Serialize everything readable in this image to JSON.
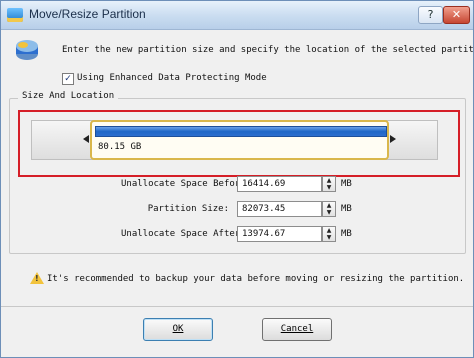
{
  "window": {
    "title": "Move/Resize Partition"
  },
  "title_buttons": {
    "help": "?",
    "close": "✕"
  },
  "intro_text": "Enter the new partition size and specify the location of the selected partition.",
  "option": {
    "label": "Using Enhanced Data Protecting Mode",
    "checked": true,
    "check_glyph": "✓"
  },
  "group": {
    "label": "Size And Location"
  },
  "partition_map": {
    "size_label": "80.15 GB",
    "left_handle": "left-resize-handle-icon",
    "right_handle": "right-resize-handle-icon"
  },
  "fields": [
    {
      "label": "Unallocate Space Before:",
      "value": "16414.69",
      "unit": "MB"
    },
    {
      "label": "Partition Size:",
      "value": "82073.45",
      "unit": "MB"
    },
    {
      "label": "Unallocate Space After:",
      "value": "13974.67",
      "unit": "MB"
    }
  ],
  "warning": {
    "icon": "warning-icon",
    "glyph": "!",
    "text": "It's recommended to backup your data before moving or resizing the partition."
  },
  "buttons": {
    "ok": "OK",
    "cancel": "Cancel"
  },
  "spin_glyphs": {
    "up": "▲",
    "down": "▼"
  },
  "colors": {
    "highlight_border": "#d51e27",
    "partition_fill": "#1f67c7",
    "accent_gold": "#d9b74b"
  }
}
